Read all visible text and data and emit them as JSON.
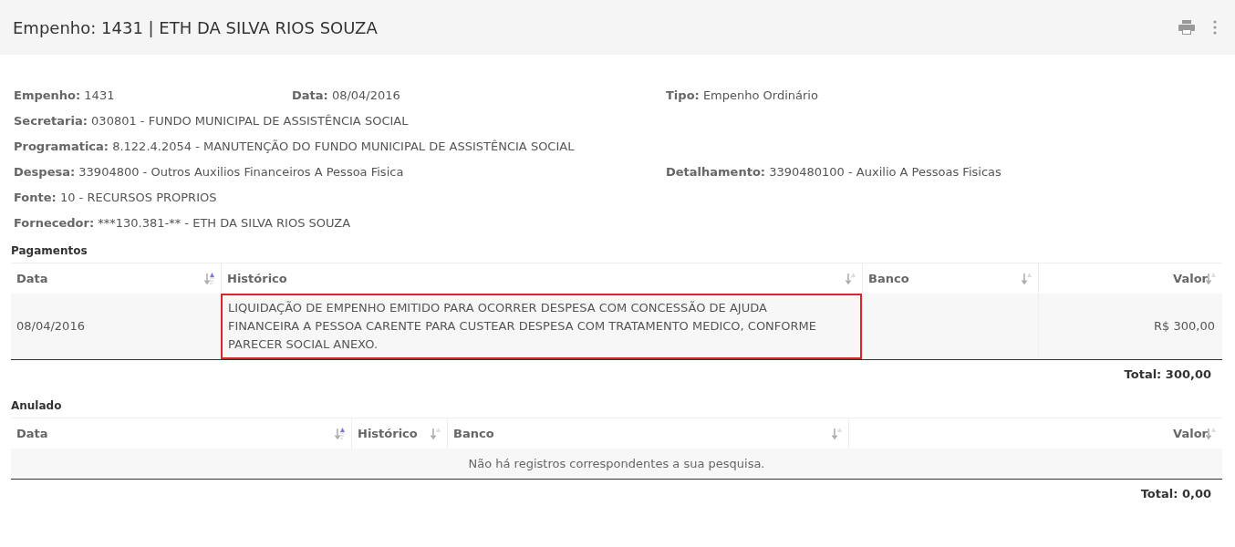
{
  "header": {
    "title": "Empenho: 1431 | ETH DA SILVA RIOS SOUZA"
  },
  "info_rows": [
    [
      {
        "label": "Empenho:",
        "value": "1431"
      },
      {
        "label": "Data:",
        "value": "08/04/2016"
      },
      {
        "label": "Tipo:",
        "value": "Empenho Ordinário"
      }
    ],
    [
      {
        "label": "Secretaria:",
        "value": "030801 - FUNDO MUNICIPAL DE ASSISTÊNCIA SOCIAL"
      }
    ],
    [
      {
        "label": "Programatica:",
        "value": "8.122.4.2054 - MANUTENÇÃO DO FUNDO MUNICIPAL DE ASSISTÊNCIA SOCIAL"
      }
    ],
    [
      {
        "label": "Despesa:",
        "value": "33904800 - Outros Auxilios Financeiros A Pessoa Fisica"
      },
      {
        "label": "Detalhamento:",
        "value": "3390480100 - Auxilio A Pessoas Fisicas"
      }
    ],
    [
      {
        "label": "Fonte:",
        "value": "10 - RECURSOS PROPRIOS"
      }
    ],
    [
      {
        "label": "Fornecedor:",
        "value": "***130.381-** - ETH DA SILVA RIOS SOUZA"
      }
    ]
  ],
  "tables": [
    {
      "title": "Pagamentos",
      "columns": [
        {
          "label": "Data",
          "sorted": true
        },
        {
          "label": "Histórico",
          "sorted": false
        },
        {
          "label": "Banco",
          "sorted": false
        },
        {
          "label": "Valor",
          "sorted": false
        }
      ],
      "rows": [
        {
          "cells": [
            {
              "text": "08/04/2016",
              "highlighted": false
            },
            {
              "text": "LIQUIDAÇÃO DE EMPENHO EMITIDO PARA OCORRER DESPESA COM CONCESSÃO DE AJUDA FINANCEIRA A PESSOA CARENTE PARA CUSTEAR DESPESA COM TRATAMENTO MEDICO, CONFORME PARECER SOCIAL ANEXO.",
              "highlighted": true
            },
            {
              "highlighted": false
            },
            {
              "text": "R$ 300,00",
              "highlighted": false
            }
          ]
        }
      ],
      "total": "Total: 300,00"
    },
    {
      "title": "Anulado",
      "columns": [
        {
          "label": "Data",
          "sorted": true
        },
        {
          "label": "Histórico",
          "sorted": false
        },
        {
          "label": "Banco",
          "sorted": false
        },
        {
          "label": "Valor",
          "sorted": false
        }
      ],
      "empty_message": "Não há registros correspondentes a sua pesquisa.",
      "total": "Total: 0,00"
    }
  ]
}
